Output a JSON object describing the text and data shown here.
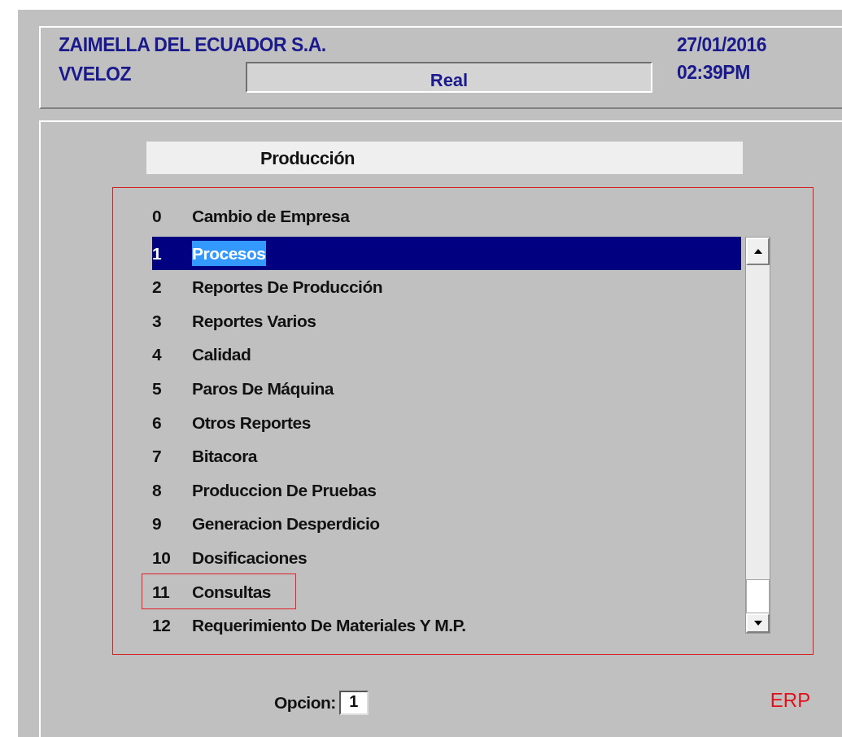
{
  "header": {
    "company": "ZAIMELLA DEL ECUADOR S.A.",
    "user": "VVELOZ",
    "environment": "Real",
    "date": "27/01/2016",
    "time": "02:39PM"
  },
  "menu": {
    "title": "Producción",
    "items": [
      {
        "number": "0",
        "label": "Cambio de Empresa",
        "selected": false,
        "outlined": false
      },
      {
        "number": "1",
        "label": "Procesos",
        "selected": true,
        "outlined": false
      },
      {
        "number": "2",
        "label": "Reportes De Producción",
        "selected": false,
        "outlined": false
      },
      {
        "number": "3",
        "label": "Reportes Varios",
        "selected": false,
        "outlined": false
      },
      {
        "number": "4",
        "label": "Calidad",
        "selected": false,
        "outlined": false
      },
      {
        "number": "5",
        "label": "Paros De Máquina",
        "selected": false,
        "outlined": false
      },
      {
        "number": "6",
        "label": "Otros Reportes",
        "selected": false,
        "outlined": false
      },
      {
        "number": "7",
        "label": "Bitacora",
        "selected": false,
        "outlined": false
      },
      {
        "number": "8",
        "label": "Produccion De Pruebas",
        "selected": false,
        "outlined": false
      },
      {
        "number": "9",
        "label": "Generacion Desperdicio",
        "selected": false,
        "outlined": false
      },
      {
        "number": "10",
        "label": "Dosificaciones",
        "selected": false,
        "outlined": false
      },
      {
        "number": "11",
        "label": "Consultas",
        "selected": false,
        "outlined": true
      },
      {
        "number": "12",
        "label": "Requerimiento De Materiales Y M.P.",
        "selected": false,
        "outlined": false
      }
    ]
  },
  "option": {
    "label": "Opcion:",
    "value": "1"
  },
  "app_label": "ERP"
}
